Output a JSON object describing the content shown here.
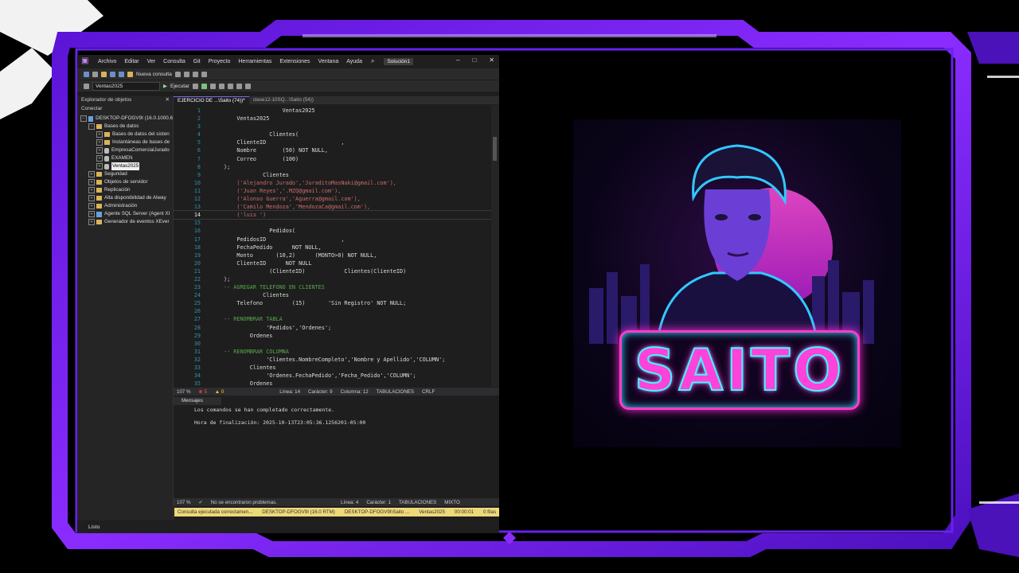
{
  "window": {
    "menu": [
      "Archivo",
      "Editar",
      "Ver",
      "Consulta",
      "Git",
      "Proyecto",
      "Herramientas",
      "Extensiones",
      "Ventana",
      "Ayuda"
    ],
    "solution": "Solución1",
    "new_query": "Nueva consulta",
    "database": "Ventas2025",
    "execute": "Ejecutar"
  },
  "object_explorer": {
    "title": "Explorador de objetos",
    "connect": "Conectar",
    "server": "DESKTOP-DFOGV9I (16.0.1000.6",
    "nodes": [
      "Bases de datos",
      "Bases de datos del sisten",
      "Instantáneas de bases de",
      "EmpresaComercialJurado",
      "EXAMEN",
      "Ventas2025",
      "Seguridad",
      "Objetos de servidor",
      "Replicación",
      "Alta disponibilidad de Alway",
      "Administración",
      "Agente SQL Server (Agent XI",
      "Generador de eventos XEver"
    ]
  },
  "tabs": [
    "EJERCICIO DE ...\\Saito (74))*",
    "clase12-10SQ...\\Saito (54))"
  ],
  "code_lines": [
    {
      "n": "1",
      "t": "                  Ventas2025"
    },
    {
      "n": "2",
      "t": "    Ventas2025"
    },
    {
      "n": "3",
      "t": ""
    },
    {
      "n": "4",
      "t": "              Clientes("
    },
    {
      "n": "5",
      "t": "    ClienteID                       ,"
    },
    {
      "n": "6",
      "t": "    Nombre        (50) NOT NULL,"
    },
    {
      "n": "7",
      "t": "    Correo        (100)       "
    },
    {
      "n": "8",
      "t": ");"
    },
    {
      "n": "9",
      "t": "            Clientes       "
    },
    {
      "n": "10",
      "t": "    ('Alejandro Jurado','JuraditoMasNaki@gmail.com'),"
    },
    {
      "n": "11",
      "t": "    ('Juan Reyes','.MZQ@gmail.com'),"
    },
    {
      "n": "12",
      "t": "    ('Alonso Guerra','Aguerra@gmail.com'),"
    },
    {
      "n": "13",
      "t": "    ('Camilo Mendoza','MendozaCa@gmail.com'),"
    },
    {
      "n": "14",
      "t": "    ('luis ')"
    },
    {
      "n": "15",
      "t": ""
    },
    {
      "n": "16",
      "t": "              Pedidos("
    },
    {
      "n": "17",
      "t": "    PedidosID                       ,"
    },
    {
      "n": "18",
      "t": "    FechaPedido      NOT NULL,"
    },
    {
      "n": "19",
      "t": "    Monto       (10,2)      (MONTO>0) NOT NULL,"
    },
    {
      "n": "20",
      "t": "    ClienteID      NOT NULL"
    },
    {
      "n": "21",
      "t": "              (ClienteID)            Clientes(ClienteID)"
    },
    {
      "n": "22",
      "t": ");"
    },
    {
      "n": "23",
      "t": "-- AGREGAR TELEFONO EN CLIENTES"
    },
    {
      "n": "24",
      "t": "            Clientes"
    },
    {
      "n": "25",
      "t": "    Telefono         (15)       'Sin Registro' NOT NULL;"
    },
    {
      "n": "26",
      "t": ""
    },
    {
      "n": "27",
      "t": "-- RENOMBRAR TABLA"
    },
    {
      "n": "28",
      "t": "             'Pedidos','Ordenes';"
    },
    {
      "n": "29",
      "t": "        Ordenes"
    },
    {
      "n": "30",
      "t": ""
    },
    {
      "n": "31",
      "t": "-- RENOMBRAR COLUMNA"
    },
    {
      "n": "32",
      "t": "             'Clientes.NombreCompleto','Nombre y Apellido','COLUMN';"
    },
    {
      "n": "33",
      "t": "        Clientes"
    },
    {
      "n": "34",
      "t": "             'Ordenes.FechaPedido','Fecha_Pedido','COLUMN';"
    },
    {
      "n": "35",
      "t": "        Ordenes"
    }
  ],
  "editor_status": {
    "zoom": "107 %",
    "errors": "5",
    "warnings": "0",
    "line": "Línea: 14",
    "char": "Carácter: 9",
    "col": "Columna: 12",
    "tabs": "TABULACIONES",
    "eol": "CRLF"
  },
  "messages": {
    "tab": "Mensajes",
    "line1": "Los comandos se han completado correctamente.",
    "line2": "Hora de finalización: 2025-10-13T23:05:36.1256201-05:00"
  },
  "messages_status": {
    "zoom": "107 %",
    "problems": "No se encontraron problemas.",
    "line": "Línea: 4",
    "char": "Carácter: 1",
    "tabs": "TABULACIONES",
    "mode": "MIXTO"
  },
  "query_bar": {
    "msg": "Consulta ejecutada correctamen...",
    "server": "DESKTOP-DFOGV9I (16.0 RTM)",
    "user": "DESKTOP-DFOGV9I\\Saito ...",
    "db": "Ventas2025",
    "time": "00:00:01",
    "rows": "0 filas"
  },
  "bottom_status": "Listo",
  "logo": {
    "text": "SAITO"
  },
  "colors": {
    "frame": "#7b2cff",
    "accent": "#ff3ccd",
    "cyan": "#48f3ff"
  }
}
